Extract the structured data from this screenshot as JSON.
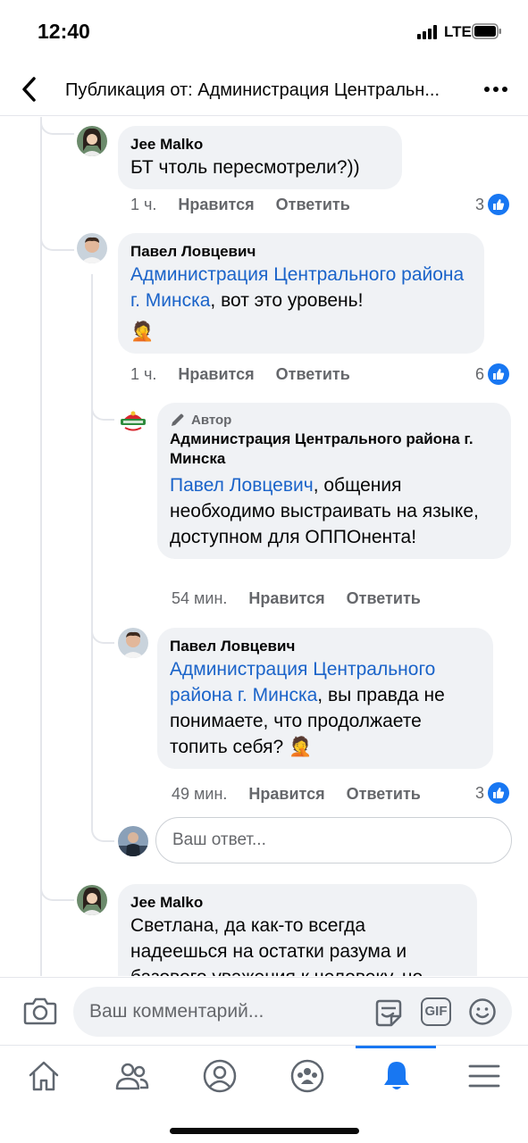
{
  "status_bar": {
    "time": "12:40",
    "network": "LTE"
  },
  "header": {
    "title": "Публикация от: Администрация Центральн..."
  },
  "comments": [
    {
      "author": "Jee Malko",
      "text": "БТ чтоль пересмотрели?))",
      "time": "1 ч.",
      "like_label": "Нравится",
      "reply_label": "Ответить",
      "likes": "3"
    },
    {
      "author": "Павел Ловцевич",
      "mention": "Администрация Центрального района г. Минска",
      "text": ", вот это уровень!",
      "emoji": "🤦",
      "time": "1 ч.",
      "like_label": "Нравится",
      "reply_label": "Ответить",
      "likes": "6"
    },
    {
      "badge": "Автор",
      "author": "Администрация Центрального района г. Минска",
      "mention": "Павел Ловцевич",
      "text": ", общения необходимо выстраивать на языке, доступном для ОППОнента!",
      "time": "54 мин.",
      "like_label": "Нравится",
      "reply_label": "Ответить"
    },
    {
      "author": "Павел Ловцевич",
      "mention": "Администрация Центрального района г. Минска",
      "text": ", вы правда не понимаете, что продолжаете топить себя?",
      "emoji": "🤦",
      "time": "49 мин.",
      "like_label": "Нравится",
      "reply_label": "Ответить",
      "likes": "3"
    },
    {
      "author": "Jee Malko",
      "text": "Светлана, да как-то всегда надеешься на остатки разума и базового уважения к человеку, но"
    }
  ],
  "reply_input": {
    "placeholder": "Ваш ответ..."
  },
  "composer": {
    "placeholder": "Ваш комментарий...",
    "gif_label": "GIF"
  },
  "colors": {
    "accent": "#1877f2",
    "mention": "#1a63c9",
    "bubble": "#f0f2f5"
  }
}
